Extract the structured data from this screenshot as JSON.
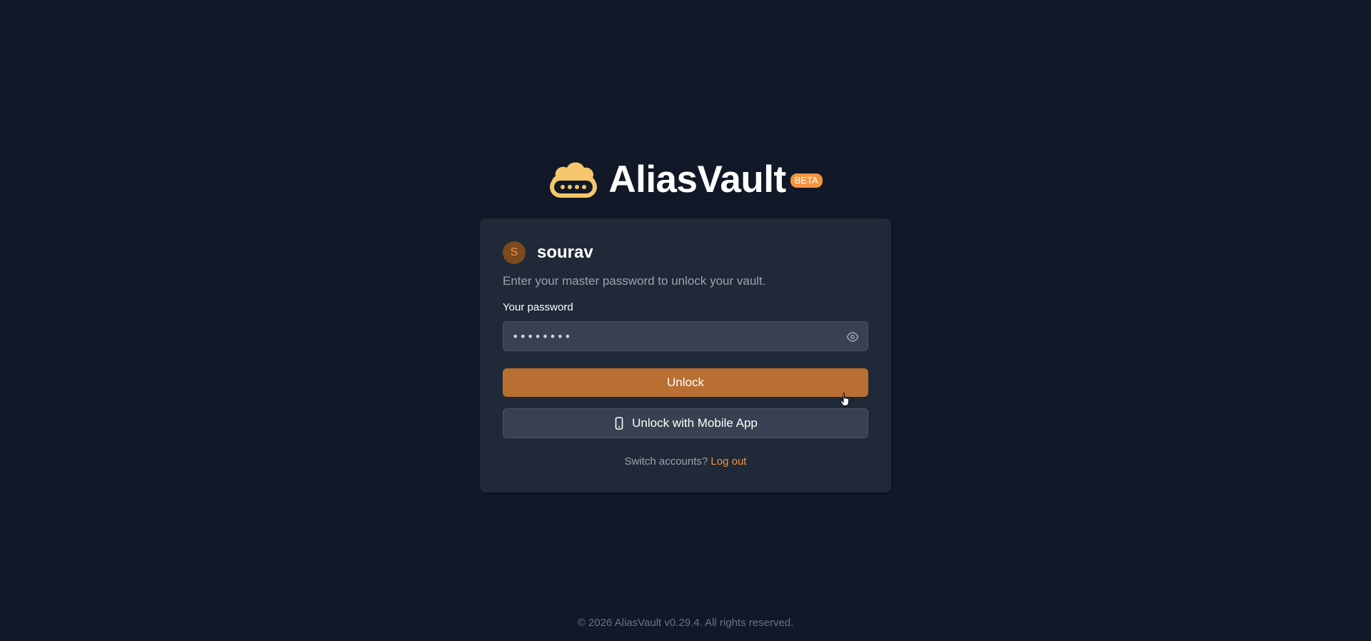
{
  "brand": {
    "logo_icon": "cloud-password-icon",
    "name": "AliasVault",
    "badge": "BETA",
    "accent_color": "#f49541"
  },
  "unlock_card": {
    "avatar_initial": "S",
    "username": "sourav",
    "subtitle": "Enter your master password to unlock your vault.",
    "password_label": "Your password",
    "password_value": "••••••••",
    "show_password_icon": "eye-icon",
    "unlock_button": "Unlock",
    "unlock_button_color": "#b86f31",
    "mobile_button": "Unlock with Mobile App",
    "mobile_icon": "smartphone-icon",
    "switch_text": "Switch accounts?",
    "logout_link": "Log out"
  },
  "footer": {
    "copyright": "© 2026 AliasVault v0.29.4. All rights reserved."
  }
}
